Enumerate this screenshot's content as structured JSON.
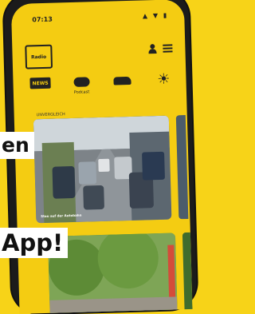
{
  "status": {
    "time": "07:13",
    "icons": "▲ ▼ ▮"
  },
  "header": {
    "logo_text": "Radio"
  },
  "categories": [
    {
      "label": ""
    },
    {
      "label": "Podcast"
    },
    {
      "label": ""
    },
    {
      "label": ""
    }
  ],
  "news_badge": "NEWS",
  "section_label": "UNVERGLEICH",
  "cards": [
    {
      "caption": "Stau auf der Autobahn"
    }
  ],
  "overlay": {
    "line1": "en",
    "line2": "App!"
  },
  "colors": {
    "brand_yellow": "#f4cc12",
    "background": "#f7d318"
  }
}
